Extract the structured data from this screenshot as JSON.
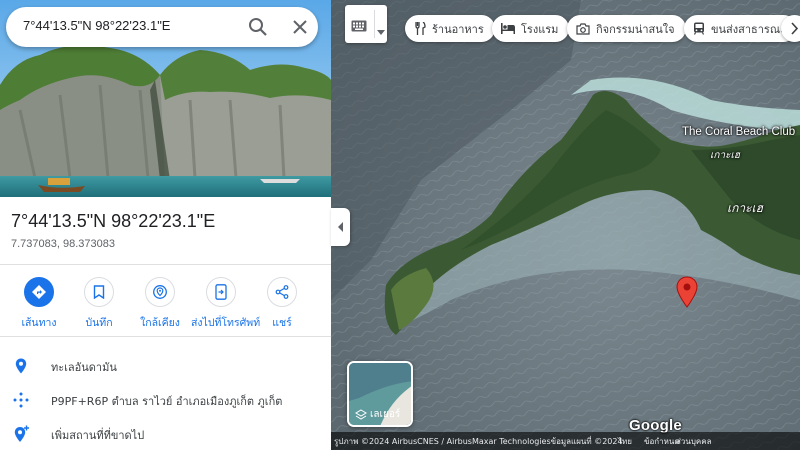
{
  "search": {
    "query": "7°44'13.5\"N 98°22'23.1\"E"
  },
  "place": {
    "title": "7°44'13.5\"N 98°22'23.1\"E",
    "decimal_coords": "7.737083, 98.373083"
  },
  "actions": [
    {
      "label": "เส้นทาง",
      "icon": "directions-icon"
    },
    {
      "label": "บันทึก",
      "icon": "bookmark-icon"
    },
    {
      "label": "ใกล้เคียง",
      "icon": "nearby-icon"
    },
    {
      "label": "ส่งไปที่โทรศัพท์",
      "icon": "send-to-phone-icon"
    },
    {
      "label": "แชร์",
      "icon": "share-icon"
    }
  ],
  "info": [
    {
      "text": "ทะเลอันดามัน",
      "icon": "location-pin-icon"
    },
    {
      "text": "P9PF+R6P ตำบล ราไวย์ อำเภอเมืองภูเก็ต ภูเก็ต",
      "icon": "plus-code-icon"
    },
    {
      "text": "เพิ่มสถานที่ที่ขาดไป",
      "icon": "add-place-icon"
    }
  ],
  "chips": [
    {
      "label": "ร้านอาหาร",
      "icon": "restaurant-icon"
    },
    {
      "label": "โรงแรม",
      "icon": "hotel-icon"
    },
    {
      "label": "กิจกรรมน่าสนใจ",
      "icon": "camera-icon"
    },
    {
      "label": "ขนส่งสาธารณะ",
      "icon": "transit-icon"
    }
  ],
  "map": {
    "poi_name": "The Coral Beach Club",
    "island_label_small": "เกาะเฮ",
    "island_label": "เกาะเฮ",
    "layers_label": "เลเยอร์",
    "google_logo": "Google",
    "attribution": "รูปภาพ ©2024 AirbusCNES / AirbusMaxar Technologiesข้อมูลแผนที่ ©2024",
    "terms": "ไทย",
    "privacy": "ข้อกำหนด",
    "feedback": "ส่วนบุคคล"
  },
  "colors": {
    "accent": "#1a73e8",
    "pin": "#ea4335",
    "poi": "#12b5cb"
  }
}
